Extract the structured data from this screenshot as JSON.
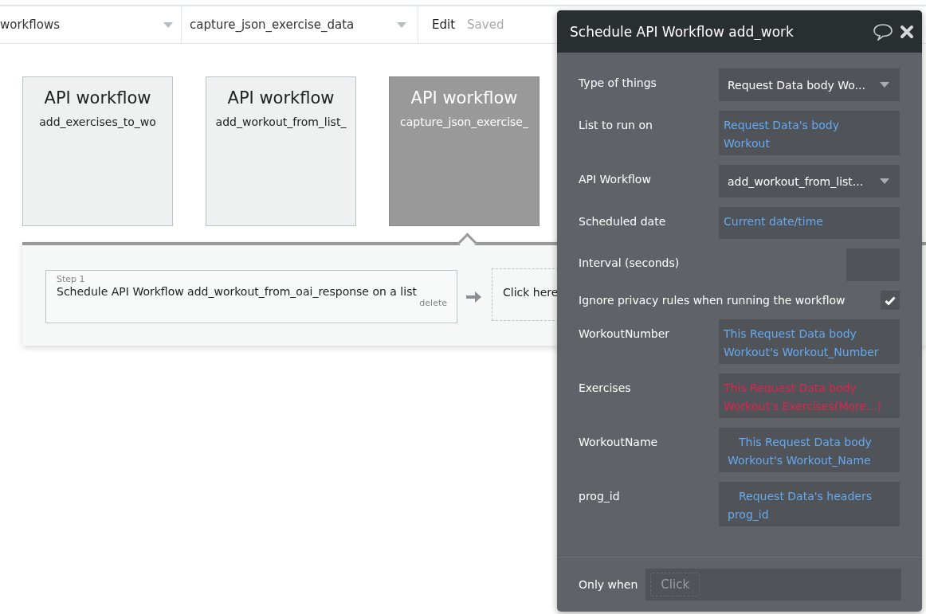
{
  "topbar": {
    "page_dropdown": "workflows",
    "workflow_dropdown": "capture_json_exercise_data",
    "edit_label": "Edit",
    "save_status": "Saved"
  },
  "workflow_cards": [
    {
      "title": "API workflow",
      "name": "add_exercises_to_wo",
      "selected": false
    },
    {
      "title": "API workflow",
      "name": "add_workout_from_list_",
      "selected": false
    },
    {
      "title": "API workflow",
      "name": "capture_json_exercise_",
      "selected": true
    }
  ],
  "steps": [
    {
      "step_label": "Step 1",
      "action": "Schedule API Workflow add_workout_from_oai_response on a list",
      "delete_label": "delete"
    }
  ],
  "add_step": {
    "label": "Click here"
  },
  "property_panel": {
    "title": "Schedule API Workflow add_work",
    "fields": [
      {
        "kind": "dropdown",
        "label": "Type of things",
        "value": "Request Data body Wo..."
      },
      {
        "kind": "expression",
        "label": "List to run on",
        "value": "Request Data's body Workout",
        "error": false
      },
      {
        "kind": "dropdown",
        "label": "API Workflow",
        "value": "add_workout_from_list..."
      },
      {
        "kind": "expression",
        "label": "Scheduled date",
        "value": "Current date/time",
        "error": false
      },
      {
        "kind": "number",
        "label": "Interval (seconds)"
      },
      {
        "kind": "checkbox",
        "label": "Ignore privacy rules when running the workflow",
        "checked": true
      },
      {
        "kind": "expression",
        "label": "WorkoutNumber",
        "value": "This Request Data body Workout's Workout_Number",
        "error": false
      },
      {
        "kind": "expression",
        "label": "Exercises",
        "value": "This Request Data body Workout's Exercises(More...)",
        "error": true
      },
      {
        "kind": "expression",
        "label": "WorkoutName",
        "value": "This Request Data body Workout's Workout_Name",
        "error": false,
        "indented": true
      },
      {
        "kind": "expression",
        "label": "prog_id",
        "value": "Request Data's headers prog_id",
        "error": false,
        "indented": true
      }
    ],
    "only_when": {
      "label": "Only when",
      "placeholder": "Click"
    }
  }
}
